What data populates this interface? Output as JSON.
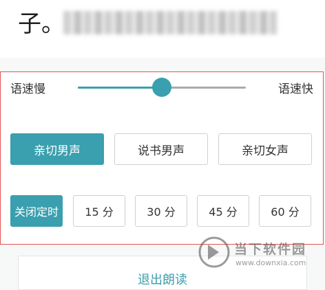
{
  "top_text": {
    "visible_char": "子。"
  },
  "speed": {
    "slow_label": "语速慢",
    "fast_label": "语速快",
    "level": 0.5
  },
  "voices": [
    {
      "label": "亲切男声",
      "selected": true
    },
    {
      "label": "说书男声",
      "selected": false
    },
    {
      "label": "亲切女声",
      "selected": false
    }
  ],
  "timers": [
    {
      "label": "关闭定时",
      "selected": true
    },
    {
      "label": "15 分",
      "selected": false
    },
    {
      "label": "30 分",
      "selected": false
    },
    {
      "label": "45 分",
      "selected": false
    },
    {
      "label": "60 分",
      "selected": false
    }
  ],
  "exit_label": "退出朗读",
  "watermark": {
    "name": "当下软件园",
    "url": "www.downxia.com"
  },
  "colors": {
    "accent": "#3a9fae",
    "highlight_border": "#e35252"
  }
}
